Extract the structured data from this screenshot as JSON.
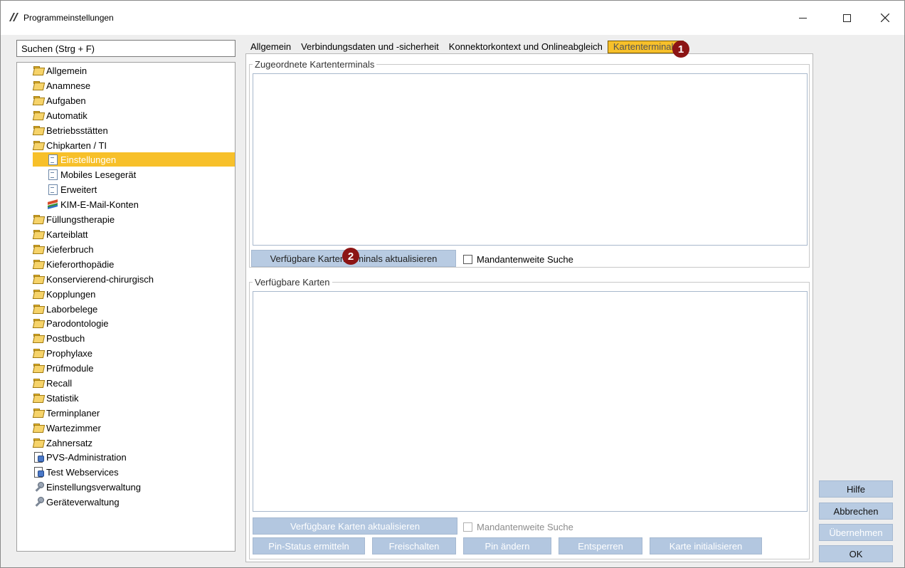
{
  "window": {
    "title": "Programmeinstellungen"
  },
  "search": {
    "placeholder": "Suchen (Strg + F)"
  },
  "tree": {
    "items": [
      {
        "label": "Allgemein",
        "icon": "folder-icon"
      },
      {
        "label": "Anamnese",
        "icon": "folder-icon"
      },
      {
        "label": "Aufgaben",
        "icon": "folder-icon"
      },
      {
        "label": "Automatik",
        "icon": "folder-icon"
      },
      {
        "label": "Betriebsstätten",
        "icon": "folder-icon"
      },
      {
        "label": "Chipkarten / TI",
        "icon": "folder-icon"
      },
      {
        "label": "Einstellungen",
        "icon": "document-icon",
        "selected": true
      },
      {
        "label": "Mobiles Lesegerät",
        "icon": "document-icon"
      },
      {
        "label": "Erweitert",
        "icon": "document-icon"
      },
      {
        "label": "KIM-E-Mail-Konten",
        "icon": "books-icon"
      },
      {
        "label": "Füllungstherapie",
        "icon": "folder-icon"
      },
      {
        "label": "Karteiblatt",
        "icon": "folder-icon"
      },
      {
        "label": "Kieferbruch",
        "icon": "folder-icon"
      },
      {
        "label": "Kieferorthopädie",
        "icon": "folder-icon"
      },
      {
        "label": "Konservierend-chirurgisch",
        "icon": "folder-icon"
      },
      {
        "label": "Kopplungen",
        "icon": "folder-icon"
      },
      {
        "label": "Laborbelege",
        "icon": "folder-icon"
      },
      {
        "label": "Parodontologie",
        "icon": "folder-icon"
      },
      {
        "label": "Postbuch",
        "icon": "folder-icon"
      },
      {
        "label": "Prophylaxe",
        "icon": "folder-icon"
      },
      {
        "label": "Prüfmodule",
        "icon": "folder-icon"
      },
      {
        "label": "Recall",
        "icon": "folder-icon"
      },
      {
        "label": "Statistik",
        "icon": "folder-icon"
      },
      {
        "label": "Terminplaner",
        "icon": "folder-icon"
      },
      {
        "label": "Wartezimmer",
        "icon": "folder-icon"
      },
      {
        "label": "Zahnersatz",
        "icon": "folder-icon"
      },
      {
        "label": "PVS-Administration",
        "icon": "admin-icon"
      },
      {
        "label": "Test Webservices",
        "icon": "admin-icon"
      },
      {
        "label": "Einstellungsverwaltung",
        "icon": "wrench-icon"
      },
      {
        "label": "Geräteverwaltung",
        "icon": "wrench-icon"
      }
    ]
  },
  "tabs": [
    {
      "label": "Allgemein"
    },
    {
      "label": "Verbindungsdaten und -sicherheit"
    },
    {
      "label": "Konnektorkontext und Onlineabgleich"
    },
    {
      "label": "Kartenterminals",
      "active": true
    }
  ],
  "terminals_group": {
    "legend": "Zugeordnete Kartenterminals",
    "refresh_button": "Verfügbare Kartenterminals aktualisieren",
    "tenant_search": "Mandantenweite Suche"
  },
  "cards_group": {
    "legend": "Verfügbare Karten",
    "refresh_button": "Verfügbare Karten aktualisieren",
    "tenant_search": "Mandantenweite Suche",
    "pin_status_button": "Pin-Status ermitteln",
    "unlock_button": "Freischalten",
    "change_pin_button": "Pin ändern",
    "unblock_button": "Entsperren",
    "init_card_button": "Karte initialisieren"
  },
  "dialog_buttons": {
    "help": "Hilfe",
    "cancel": "Abbrechen",
    "apply": "Übernehmen",
    "ok": "OK"
  },
  "markers": {
    "one": "1",
    "two": "2"
  },
  "colors": {
    "selection": "#f7c02a",
    "button": "#b8cbe2",
    "marker": "#8c1414"
  }
}
